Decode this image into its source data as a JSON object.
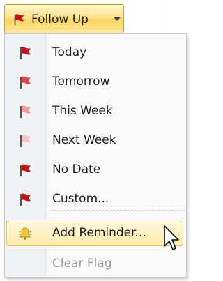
{
  "follow_up": {
    "label": "Follow Up",
    "icon": "red-flag-icon"
  },
  "menu": {
    "items": [
      {
        "label": "Today",
        "icon": "flag-today-icon"
      },
      {
        "label": "Tomorrow",
        "icon": "flag-tomorrow-icon"
      },
      {
        "label": "This Week",
        "icon": "flag-this-week-icon"
      },
      {
        "label": "Next Week",
        "icon": "flag-next-week-icon"
      },
      {
        "label": "No Date",
        "icon": "flag-no-date-icon"
      },
      {
        "label": "Custom...",
        "icon": "flag-custom-icon"
      },
      {
        "label": "Add Reminder...",
        "icon": "bell-icon",
        "state": "highlighted"
      },
      {
        "label": "Clear Flag",
        "icon": "",
        "state": "disabled"
      }
    ]
  },
  "colors": {
    "flag_dark": "#c0141a",
    "flag_light": "#f29a9a",
    "highlight": "#ffeaa8",
    "disabled_text": "#9c9c9c"
  }
}
